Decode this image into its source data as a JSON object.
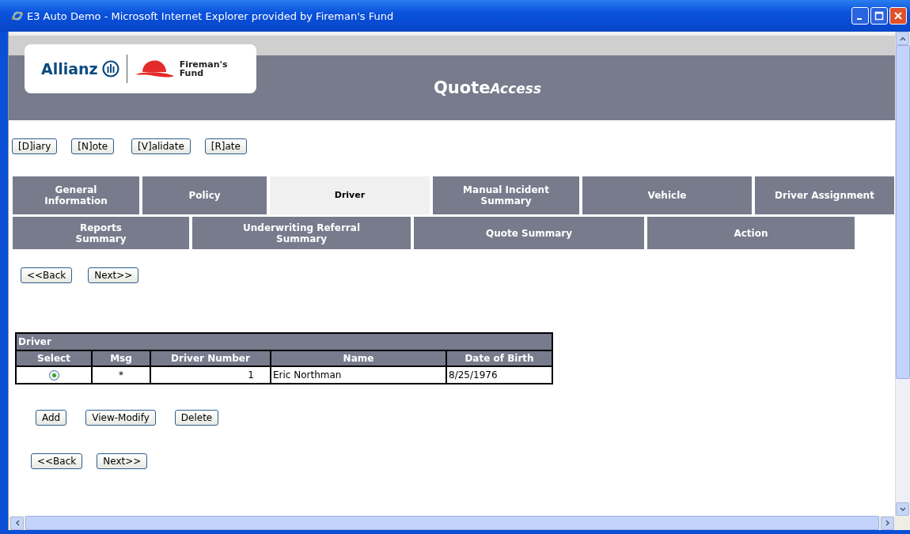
{
  "window": {
    "title": "E3 Auto Demo - Microsoft Internet Explorer provided by Fireman's Fund"
  },
  "header": {
    "logo_left": "Allianz",
    "logo_right": [
      "Fireman's",
      "Fund"
    ],
    "app_name": {
      "main": "Quote",
      "suffix": "Access"
    }
  },
  "toolbar": [
    "[D]iary",
    "[N]ote",
    "[V]alidate",
    "[R]ate"
  ],
  "tab_rows": [
    [
      {
        "label": "General\nInformation",
        "selected": false
      },
      {
        "label": "Policy",
        "selected": false
      },
      {
        "label": "Driver",
        "selected": true
      },
      {
        "label": "Manual Incident\nSummary",
        "selected": false
      },
      {
        "label": "Vehicle",
        "selected": false
      },
      {
        "label": "Driver Assignment",
        "selected": false
      }
    ],
    [
      {
        "label": "Reports\nSummary",
        "selected": false
      },
      {
        "label": "Underwriting Referral\nSummary",
        "selected": false
      },
      {
        "label": "Quote Summary",
        "selected": false
      },
      {
        "label": "Action",
        "selected": false
      }
    ]
  ],
  "nav_top": [
    "<<Back",
    "Next>>"
  ],
  "table": {
    "title": "Driver",
    "columns": [
      "Select",
      "Msg",
      "Driver Number",
      "Name",
      "Date of Birth"
    ],
    "rows": [
      {
        "selected": true,
        "msg": "*",
        "driver_number": "1",
        "name": "Eric Northman",
        "date_of_birth": "8/25/1976"
      }
    ]
  },
  "actions": [
    "Add",
    "View-Modify",
    "Delete"
  ],
  "nav_bottom": [
    "<<Back",
    "Next>>"
  ]
}
